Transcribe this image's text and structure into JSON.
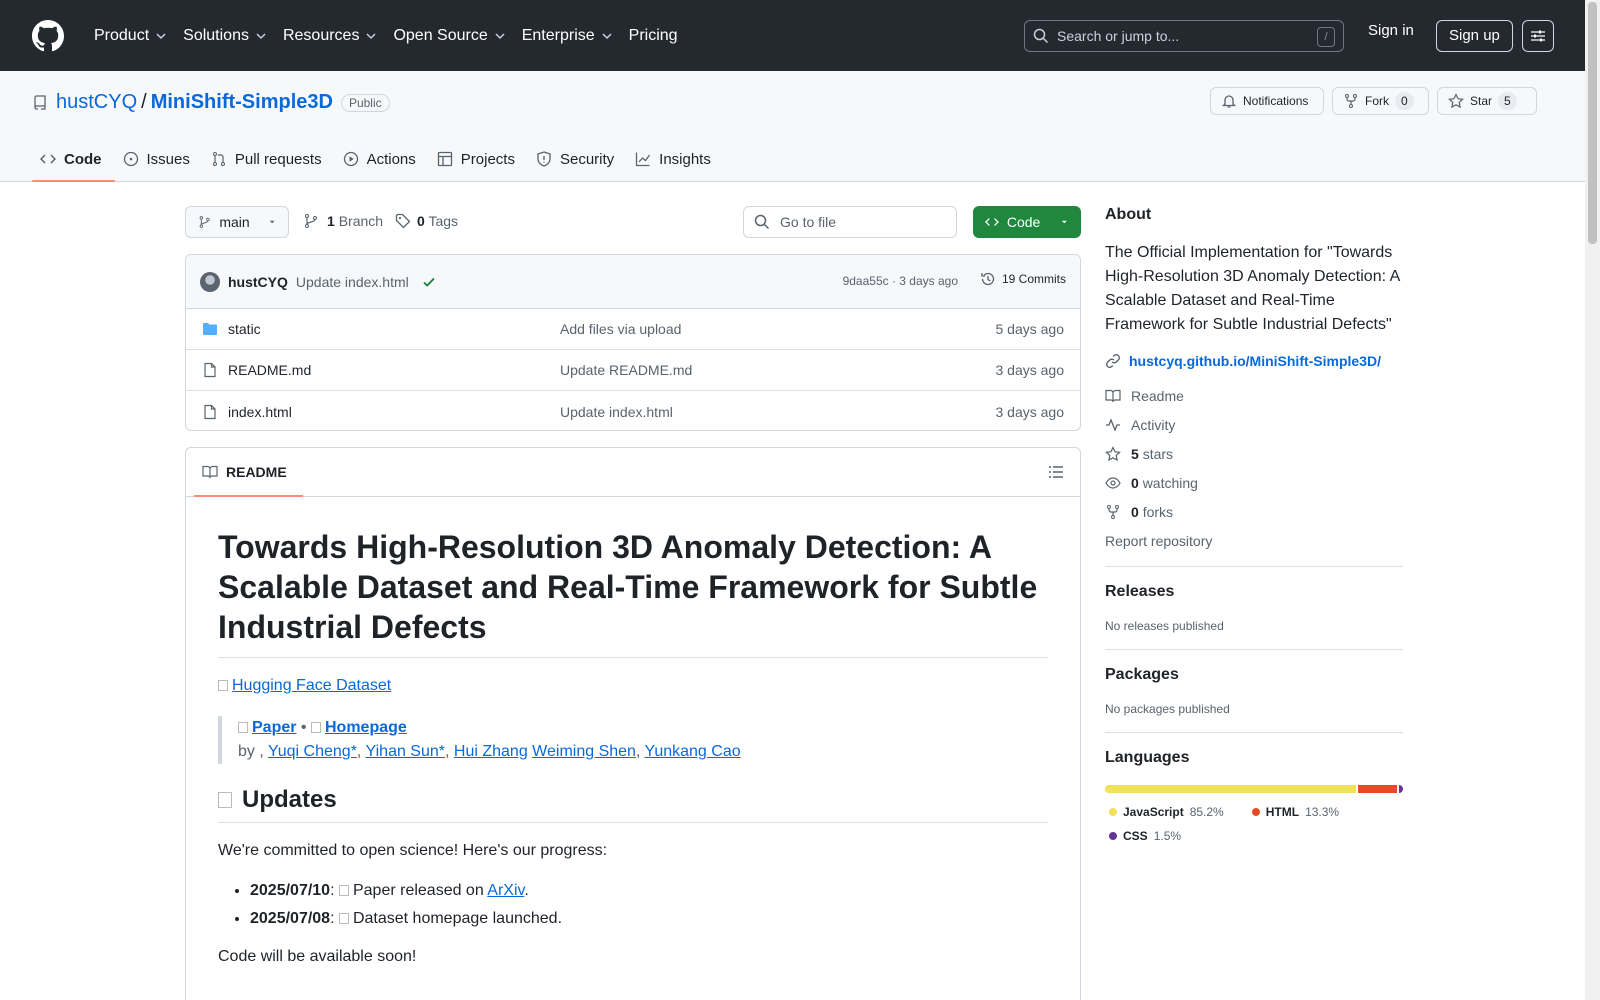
{
  "header": {
    "nav": [
      "Product",
      "Solutions",
      "Resources",
      "Open Source",
      "Enterprise",
      "Pricing"
    ],
    "search_placeholder": "Search or jump to...",
    "search_key": "/",
    "signin": "Sign in",
    "signup": "Sign up"
  },
  "repo": {
    "owner": "hustCYQ",
    "name": "MiniShift-Simple3D",
    "visibility": "Public",
    "notifications": "Notifications",
    "fork_label": "Fork",
    "fork_count": "0",
    "star_label": "Star",
    "star_count": "5",
    "tabs": [
      "Code",
      "Issues",
      "Pull requests",
      "Actions",
      "Projects",
      "Security",
      "Insights"
    ]
  },
  "toolbar": {
    "branch": "main",
    "branches_count": "1",
    "branches_label": "Branch",
    "tags_count": "0",
    "tags_label": "Tags",
    "goto_file": "Go to file",
    "code_button": "Code"
  },
  "latest_commit": {
    "author": "hustCYQ",
    "message": "Update index.html",
    "meta": "9daa55c · 3 days ago",
    "commits": "19 Commits"
  },
  "files": [
    {
      "name": "static",
      "type": "folder",
      "message": "Add files via upload",
      "date": "5 days ago"
    },
    {
      "name": "README.md",
      "type": "file",
      "message": "Update README.md",
      "date": "3 days ago"
    },
    {
      "name": "index.html",
      "type": "file",
      "message": "Update index.html",
      "date": "3 days ago"
    }
  ],
  "readme": {
    "tab_label": "README",
    "title": "Towards High-Resolution 3D Anomaly Detection: A Scalable Dataset and Real-Time Framework for Subtle Industrial Defects",
    "hf_link": "Hugging Face Dataset",
    "paper_link": "Paper",
    "bullet": "•",
    "homepage_link": "Homepage",
    "by": "by ,",
    "authors": [
      "Yuqi Cheng*",
      "Yihan Sun*",
      "Hui Zhang",
      "Weiming Shen",
      "Yunkang Cao"
    ],
    "updates_heading": "Updates",
    "updates_intro": "We're committed to open science! Here's our progress:",
    "updates": [
      {
        "date": "2025/07/10",
        "text_before": "Paper released on ",
        "link": "ArXiv",
        "text_after": "."
      },
      {
        "date": "2025/07/08",
        "text_before": "Dataset homepage launched.",
        "link": "",
        "text_after": ""
      }
    ],
    "footer_text": "Code will be available soon!"
  },
  "sidebar": {
    "about_heading": "About",
    "description": "The Official Implementation for \"Towards High-Resolution 3D Anomaly Detection: A Scalable Dataset and Real-Time Framework for Subtle Industrial Defects\"",
    "homepage": "hustcyq.github.io/MiniShift-Simple3D/",
    "readme": "Readme",
    "activity": "Activity",
    "stars_count": "5",
    "stars_label": "stars",
    "watching_count": "0",
    "watching_label": "watching",
    "forks_count": "0",
    "forks_label": "forks",
    "report": "Report repository",
    "releases_heading": "Releases",
    "releases_text": "No releases published",
    "packages_heading": "Packages",
    "packages_text": "No packages published",
    "languages_heading": "Languages",
    "languages": [
      {
        "name": "JavaScript",
        "percent": "85.2%",
        "value": 85.2,
        "color": "#f1e05a"
      },
      {
        "name": "HTML",
        "percent": "13.3%",
        "value": 13.3,
        "color": "#e34c26"
      },
      {
        "name": "CSS",
        "percent": "1.5%",
        "value": 1.5,
        "color": "#663399"
      }
    ]
  }
}
